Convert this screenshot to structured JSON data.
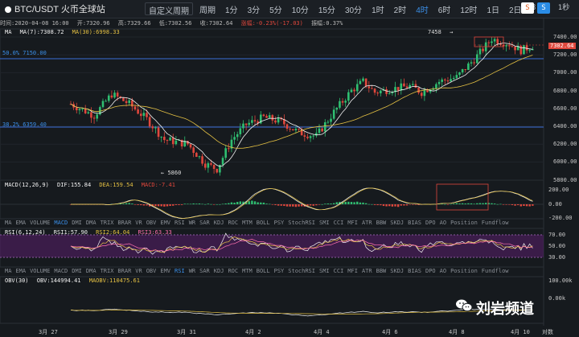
{
  "header": {
    "pair": "BTC/USDT 火币全球站",
    "menu_items": [
      "周期",
      "1分",
      "3分",
      "5分",
      "10分",
      "15分",
      "30分",
      "1时",
      "2时",
      "4时",
      "6时",
      "12时",
      "1日",
      "2日",
      "3"
    ],
    "custom_period": "自定义周期",
    "active_item": "4时",
    "right_icons": [
      "S",
      "S",
      "1秒"
    ]
  },
  "info": {
    "time": "时间:2020-04-08 16:00",
    "open": "开:7320.96",
    "high": "高:7329.66",
    "low": "低:7302.56",
    "close": "收:7302.64",
    "change": "涨幅:-0.23%(-17.03)",
    "amplitude": "振幅:0.37%"
  },
  "main_pane": {
    "ma_label": "MA",
    "ma7": "MA(7):7308.72",
    "ma30": "MA(30):6998.33",
    "fib_50": "50.0% 7150.00",
    "fib_382": "38.2% 6359.40",
    "high_marker": "7458",
    "low_marker": "5860",
    "last_price": "7302.64",
    "y_ticks": [
      "7400.00",
      "7200.00",
      "7000.00",
      "6800.00",
      "6600.00",
      "6400.00",
      "6200.00",
      "6000.00",
      "5800.00"
    ]
  },
  "macd_pane": {
    "label": "MACD(12,26,9)",
    "dif": "DIF:155.84",
    "dea": "DEA:159.54",
    "macd": "MACD:-7.41",
    "y_ticks": [
      "200.00",
      "0.00",
      "-200.00"
    ]
  },
  "rsi_pane": {
    "label": "RSI(6,12,24)",
    "rsi1": "RSI1:57.90",
    "rsi2": "RSI2:64.04",
    "rsi3": "RSI3:63.33",
    "y_ticks": [
      "70.00",
      "50.00",
      "30.00"
    ]
  },
  "obv_pane": {
    "label": "OBV(30)",
    "obv": "OBV:144994.41",
    "maobv": "MAOBV:110475.61",
    "y_ticks": [
      "100.00k",
      "0.00k"
    ]
  },
  "indicator_tabs": [
    "MA",
    "EMA",
    "VOLUME",
    "MACD",
    "DMI",
    "DMA",
    "TRIX",
    "BRAR",
    "VR",
    "OBV",
    "EMV",
    "RSI",
    "WR",
    "SAR",
    "KDJ",
    "ROC",
    "MTM",
    "BOLL",
    "PSY",
    "StochRSI",
    "SMI",
    "CCI",
    "MFI",
    "ATR",
    "BBW",
    "SKDJ",
    "BIAS",
    "DPO",
    "AO",
    "Position",
    "Fundflow"
  ],
  "indicator_tabs_active_1": "MACD",
  "indicator_tabs_active_2": "RSI",
  "x_labels": [
    "3月 27",
    "3月 29",
    "3月 31",
    "4月 2",
    "4月 4",
    "4月 6",
    "4月 8",
    "4月 10"
  ],
  "x_right": "对数",
  "watermark": "刘岩频道",
  "colors": {
    "up": "#2fbf71",
    "down": "#e0473c",
    "ma7": "#f2f2f2",
    "ma30": "#e5c143",
    "fib": "#3b6fd8",
    "rsi_band": "#5a1f6b"
  }
}
